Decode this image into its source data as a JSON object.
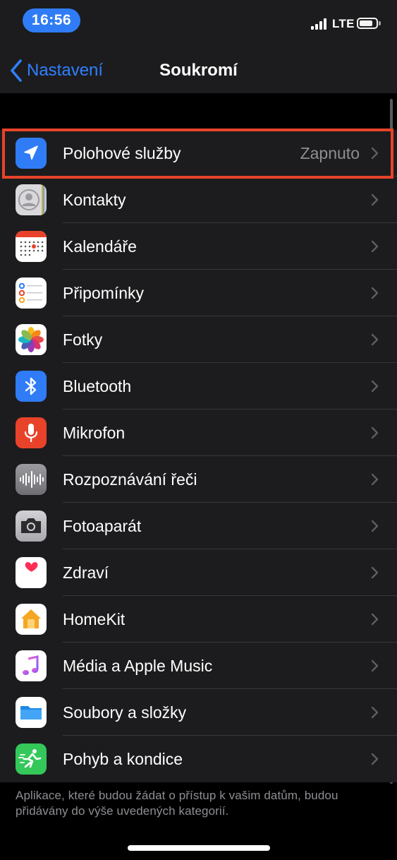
{
  "status_bar": {
    "time": "16:56",
    "network": "LTE"
  },
  "nav": {
    "back_label": "Nastavení",
    "title": "Soukromí"
  },
  "rows": [
    {
      "label": "Polohové služby",
      "value": "Zapnuto",
      "icon": "location-arrow-icon",
      "highlighted": true
    },
    {
      "label": "Kontakty",
      "value": "",
      "icon": "contacts-icon"
    },
    {
      "label": "Kalendáře",
      "value": "",
      "icon": "calendar-icon"
    },
    {
      "label": "Připomínky",
      "value": "",
      "icon": "reminders-icon"
    },
    {
      "label": "Fotky",
      "value": "",
      "icon": "photos-icon"
    },
    {
      "label": "Bluetooth",
      "value": "",
      "icon": "bluetooth-icon"
    },
    {
      "label": "Mikrofon",
      "value": "",
      "icon": "microphone-icon"
    },
    {
      "label": "Rozpoznávání řeči",
      "value": "",
      "icon": "speech-recognition-icon"
    },
    {
      "label": "Fotoaparát",
      "value": "",
      "icon": "camera-icon"
    },
    {
      "label": "Zdraví",
      "value": "",
      "icon": "health-heart-icon"
    },
    {
      "label": "HomeKit",
      "value": "",
      "icon": "home-icon"
    },
    {
      "label": "Média a Apple Music",
      "value": "",
      "icon": "music-note-icon"
    },
    {
      "label": "Soubory a složky",
      "value": "",
      "icon": "folder-icon"
    },
    {
      "label": "Pohyb a kondice",
      "value": "",
      "icon": "motion-fitness-icon"
    }
  ],
  "footer_text": "Aplikace, které budou žádat o přístup k vašim datům, budou přidávány do výše uvedených kategorií.",
  "colors": {
    "accent": "#2f80ff",
    "highlight": "#e8432a",
    "background": "#000000",
    "cell": "#1c1c1e"
  }
}
